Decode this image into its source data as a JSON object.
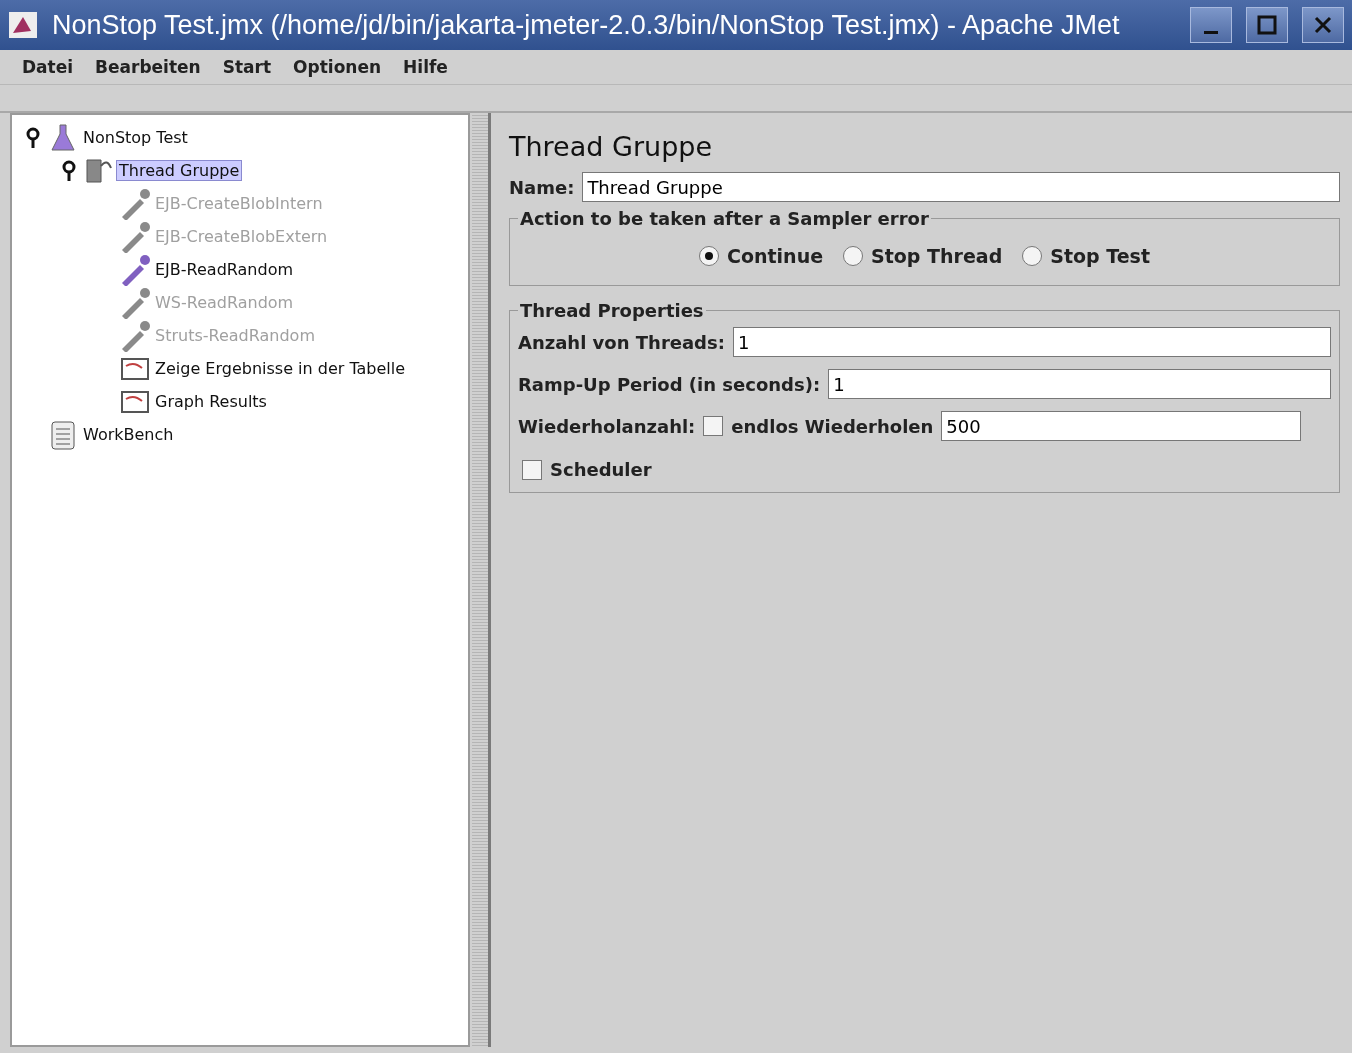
{
  "window": {
    "title": "NonStop Test.jmx (/home/jd/bin/jakarta-jmeter-2.0.3/bin/NonStop Test.jmx) - Apache JMet"
  },
  "menu": [
    "Datei",
    "Bearbeiten",
    "Start",
    "Optionen",
    "Hilfe"
  ],
  "tree": [
    {
      "label": "NonStop Test",
      "kind": "plan",
      "enabled": true,
      "selected": false,
      "expanded": true,
      "children": [
        {
          "label": "Thread Gruppe",
          "kind": "threads",
          "enabled": true,
          "selected": true,
          "expanded": true,
          "children": [
            {
              "label": "EJB-CreateBlobIntern",
              "kind": "sampler",
              "enabled": false,
              "selected": false
            },
            {
              "label": "EJB-CreateBlobExtern",
              "kind": "sampler",
              "enabled": false,
              "selected": false
            },
            {
              "label": "EJB-ReadRandom",
              "kind": "sampler",
              "enabled": true,
              "selected": false
            },
            {
              "label": "WS-ReadRandom",
              "kind": "sampler",
              "enabled": false,
              "selected": false
            },
            {
              "label": "Struts-ReadRandom",
              "kind": "sampler",
              "enabled": false,
              "selected": false
            },
            {
              "label": "Zeige Ergebnisse in der Tabelle",
              "kind": "listener",
              "enabled": true,
              "selected": false
            },
            {
              "label": "Graph Results",
              "kind": "listener",
              "enabled": true,
              "selected": false
            }
          ]
        }
      ]
    },
    {
      "label": "WorkBench",
      "kind": "workbench",
      "enabled": true,
      "selected": false
    }
  ],
  "panel": {
    "title": "Thread Gruppe",
    "name_label": "Name:",
    "name_value": "Thread Gruppe",
    "error_group": {
      "title": "Action to be taken after a Sampler error",
      "options": [
        {
          "label": "Continue",
          "selected": true
        },
        {
          "label": "Stop Thread",
          "selected": false
        },
        {
          "label": "Stop Test",
          "selected": false
        }
      ]
    },
    "properties": {
      "title": "Thread Properties",
      "threads_label": "Anzahl von Threads:",
      "threads_value": "1",
      "rampup_label": "Ramp-Up Period (in seconds):",
      "rampup_value": "1",
      "loop_label": "Wiederholanzahl:",
      "forever_label": "endlos Wiederholen",
      "forever_checked": false,
      "loop_value": "500",
      "scheduler_label": "Scheduler",
      "scheduler_checked": false
    }
  }
}
